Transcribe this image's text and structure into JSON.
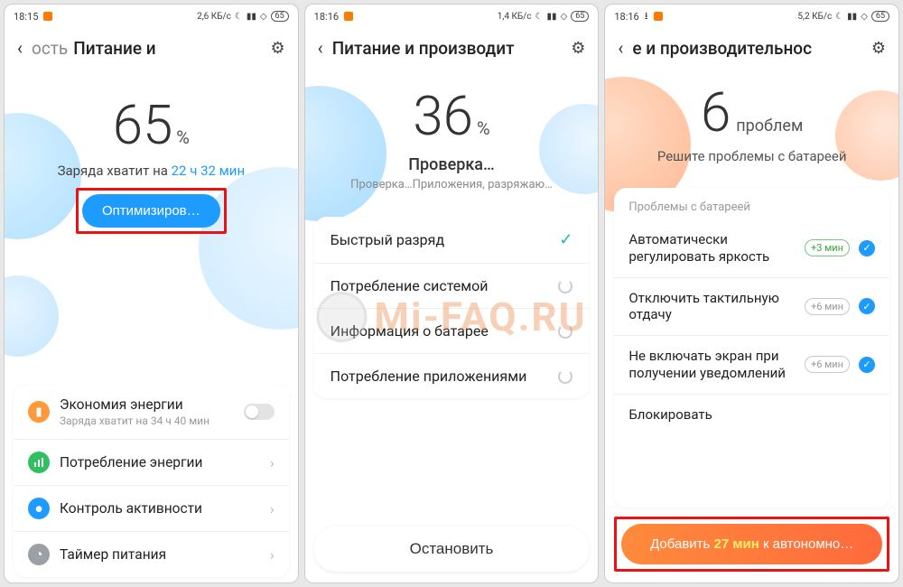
{
  "watermark": "Mi-FAQ.RU",
  "screens": [
    {
      "status": {
        "time": "18:15",
        "net": "2,6 КБ/с",
        "battery": "65"
      },
      "header": {
        "prev": "ость",
        "title": "Питание и"
      },
      "big": {
        "value": "65",
        "pct": "%",
        "sub_pre": "Заряда хватит на ",
        "sub_hl": "22 ч 32 мин"
      },
      "optimize_btn": "Оптимизиров…",
      "rows": {
        "saver": {
          "title": "Экономия энергии",
          "sub": "Заряда хватит на 34 ч 40 мин"
        },
        "usage": "Потребление энергии",
        "activity": "Контроль активности",
        "timer": "Таймер питания"
      }
    },
    {
      "status": {
        "time": "18:16",
        "net": "1,4 КБ/с",
        "battery": "65"
      },
      "header": {
        "title": "Питание и производит"
      },
      "big": {
        "value": "36",
        "pct": "%",
        "checking": "Проверка…",
        "checksub": "Проверка…Приложения, разряжаю…"
      },
      "items": {
        "a": "Быстрый разряд",
        "b": "Потребление системой",
        "c": "Информация о батарее",
        "d": "Потребление приложениями"
      },
      "stop": "Остановить"
    },
    {
      "status": {
        "time": "18:16",
        "net": "5,2 КБ/с",
        "battery": "65"
      },
      "header": {
        "title": "е и производительнос"
      },
      "big": {
        "value": "6",
        "word": "проблем",
        "sub": "Решите проблемы с батареей"
      },
      "card_header": "Проблемы с батареей",
      "problems": {
        "p1": {
          "text": "Автоматически регулировать яркость",
          "badge": "+3 мин"
        },
        "p2": {
          "text": "Отключить тактильную отдачу",
          "badge": "+6 мин"
        },
        "p3": {
          "text": "Не включать экран при получении уведомлений",
          "badge": "+6 мин"
        },
        "p4": {
          "text": "Блокировать"
        }
      },
      "action": {
        "pre": "Добавить ",
        "em": "27 мин",
        "post": " к автономно…"
      }
    }
  ]
}
